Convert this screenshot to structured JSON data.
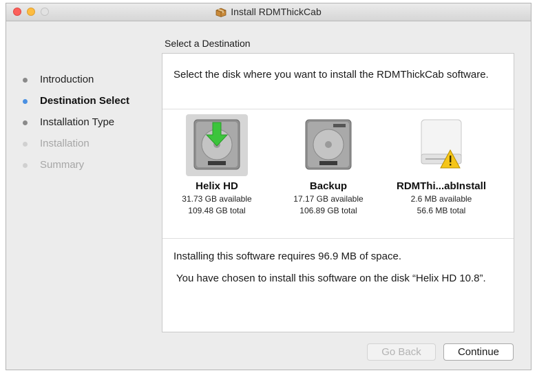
{
  "window": {
    "title": "Install RDMThickCab"
  },
  "section_title": "Select a Destination",
  "steps": [
    {
      "label": "Introduction",
      "state": "done"
    },
    {
      "label": "Destination Select",
      "state": "active"
    },
    {
      "label": "Installation Type",
      "state": "done"
    },
    {
      "label": "Installation",
      "state": "future"
    },
    {
      "label": "Summary",
      "state": "future"
    }
  ],
  "prompt": "Select the disk where you want to install the RDMThickCab software.",
  "disks": [
    {
      "name": "Helix HD",
      "available": "31.73 GB available",
      "total": "109.48 GB total",
      "icon": "internal-disk-install-icon",
      "selected": true
    },
    {
      "name": "Backup",
      "available": "17.17 GB available",
      "total": "106.89 GB total",
      "icon": "internal-disk-icon",
      "selected": false
    },
    {
      "name": "RDMThi...abInstall",
      "available": "2.6 MB available",
      "total": "56.6 MB total",
      "icon": "external-disk-warning-icon",
      "selected": false
    }
  ],
  "requirement": "Installing this software requires 96.9 MB of space.",
  "chosen": "You have chosen to install this software on the disk “Helix HD 10.8”.",
  "buttons": {
    "back": "Go Back",
    "continue": "Continue"
  },
  "colors": {
    "active_step": "#4a90e2",
    "install_arrow": "#3cc43c",
    "warning": "#f5c518"
  }
}
